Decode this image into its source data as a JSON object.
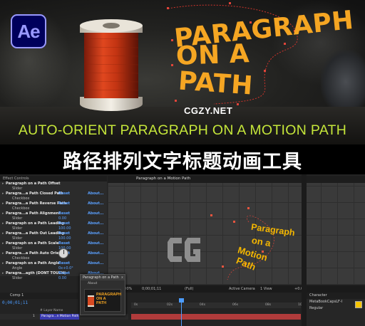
{
  "hero": {
    "logo_text": "Ae",
    "title_lines": [
      "PARAGRAPH",
      "ON A",
      "PATH"
    ],
    "watermark": "CGZY.NET",
    "subtitle": "AUTO-ORIENT PARAGRAPH ON A MOTION PATH",
    "colors": {
      "title": "#f5a623",
      "subtitle": "#c5e63a",
      "logo_bg": "#00005b",
      "logo_fg": "#9999ff"
    }
  },
  "banner": {
    "text": "路径排列文字标题动画工具"
  },
  "ae": {
    "effects_panel": {
      "header": "Effect Controls",
      "rows": [
        {
          "type": "main",
          "label": "Paragraph on a Path Offset",
          "value": "",
          "about": ""
        },
        {
          "type": "sub",
          "label": "Slider",
          "value": "",
          "about": ""
        },
        {
          "type": "main",
          "label": "Paragra...a Path Closed Path",
          "value": "Reset",
          "about": "About..."
        },
        {
          "type": "sub",
          "label": "Checkbox",
          "value": "",
          "about": ""
        },
        {
          "type": "main",
          "label": "Paragra...a Path Reverse Path",
          "value": "Reset",
          "about": "About..."
        },
        {
          "type": "sub",
          "label": "Checkbox",
          "value": "",
          "about": ""
        },
        {
          "type": "main",
          "label": "Paragra...a Path Alignment",
          "value": "Reset",
          "about": "About..."
        },
        {
          "type": "sub",
          "label": "Slider",
          "value": "0.00",
          "about": ""
        },
        {
          "type": "main",
          "label": "Paragraph on a Path Leading",
          "value": "Reset",
          "about": "About..."
        },
        {
          "type": "sub",
          "label": "Slider",
          "value": "100.00",
          "about": ""
        },
        {
          "type": "main",
          "label": "Paragra...a Path Out Leading",
          "value": "Reset",
          "about": "About..."
        },
        {
          "type": "sub",
          "label": "Slider",
          "value": "100.00",
          "about": ""
        },
        {
          "type": "main",
          "label": "Paragraph on a Path Scale",
          "value": "Reset",
          "about": "About..."
        },
        {
          "type": "sub",
          "label": "Slider",
          "value": "100.00",
          "about": ""
        },
        {
          "type": "main",
          "label": "Paragra...a Path Auto Orient",
          "value": "Reset",
          "about": "About..."
        },
        {
          "type": "sub",
          "label": "Checkbox",
          "value": "",
          "about": ""
        },
        {
          "type": "main",
          "label": "Paragraph on a Path Angle",
          "value": "Reset",
          "about": "About..."
        },
        {
          "type": "sub",
          "label": "Angle",
          "value": "0x+0.0°",
          "about": ""
        },
        {
          "type": "main",
          "label": "Paragra...agth (DONT TOUCH)",
          "value": "Reset",
          "about": "About..."
        },
        {
          "type": "sub",
          "label": "Slider",
          "value": "0.00",
          "about": ""
        }
      ]
    },
    "comp_panel": {
      "tab": "Paragraph on a Motion Path",
      "text_lines": [
        "Paragraph",
        "on a",
        "Motion",
        "Path",
        "Path"
      ]
    },
    "about_window": {
      "title": "Paragraph on a Path",
      "close": "x",
      "about_label": "About",
      "thumb_lines": [
        "PARAGRAPH",
        "ON A",
        "PATH"
      ]
    },
    "toolbar": {
      "zoom": "100%",
      "timecode": "0;00;01;11",
      "resolution": "(Full)",
      "camera": "Active Camera",
      "views": "1 View",
      "offset": "+0.0"
    },
    "timeline": {
      "tab": "Comp 1",
      "timecode": "0;00;01;11",
      "header": "# Layer Name",
      "layer_num": "1",
      "layer_name": "Paragra...n Motion Path",
      "ticks": [
        "0s",
        "02s",
        "04s",
        "06s",
        "08s",
        "10s"
      ]
    },
    "character_panel": {
      "header": "Character",
      "font": "MetaBookCapsLF-I",
      "style": "Regular",
      "swatch_color": "#f5c400"
    }
  }
}
